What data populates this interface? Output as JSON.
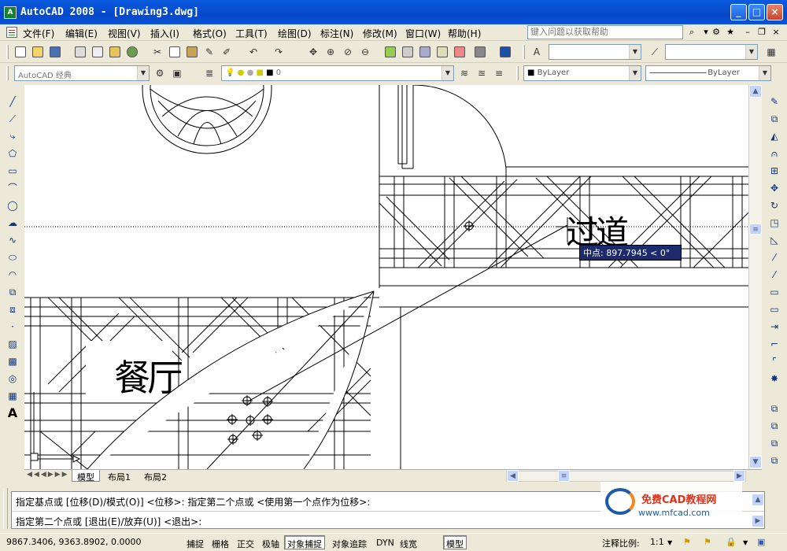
{
  "title": "AutoCAD 2008 - [Drawing3.dwg]",
  "app_icon_label": "A",
  "window_controls": {
    "minimize": "_",
    "maximize": "□",
    "close": "×"
  },
  "menu": [
    "文件(F)",
    "编辑(E)",
    "视图(V)",
    "插入(I)",
    "格式(O)",
    "工具(T)",
    "绘图(D)",
    "标注(N)",
    "修改(M)",
    "窗口(W)",
    "帮助(H)"
  ],
  "help_search": {
    "placeholder": "键入问题以获取帮助"
  },
  "doc_controls": {
    "minimize": "–",
    "restore": "❐",
    "close": "×"
  },
  "workspace": {
    "value": "AutoCAD 经典"
  },
  "layer": {
    "value": "0"
  },
  "color": {
    "value": "ByLayer"
  },
  "linetype": {
    "value": "ByLayer"
  },
  "drawing": {
    "label_restaurant": "餐厅",
    "label_corridor": "过道",
    "tooltip": "中点: 897.7945 < 0°"
  },
  "tabs": [
    "模型",
    "布局1",
    "布局2"
  ],
  "active_tab": "模型",
  "command": {
    "line1": "指定基点或 [位移(D)/模式(O)] <位移>: 指定第二个点或 <使用第一个点作为位移>:",
    "line2": "指定第二个点或 [退出(E)/放弃(U)] <退出>:"
  },
  "watermark": {
    "site": "www.mfcad.com",
    "name": "免费CAD教程网"
  },
  "status": {
    "coords": "9867.3406, 9363.8902, 0.0000",
    "toggles": [
      "捕捉",
      "栅格",
      "正交",
      "极轴",
      "对象捕捉",
      "对象追踪",
      "DYN",
      "线宽",
      "模型"
    ],
    "toggles_on": [
      "对象捕捉",
      "模型"
    ],
    "annotation_scale_label": "注释比例:",
    "annotation_scale_value": "1:1"
  },
  "colors": {
    "titlebar": "#0A53D6",
    "chrome": "#ECE9D8",
    "tooltip_bg": "#1D2A6B",
    "canvas": "#FFFFFF"
  },
  "icons": {
    "left_toolbar": [
      "line-icon",
      "construction-line-icon",
      "polyline-icon",
      "polygon-icon",
      "rectangle-icon",
      "arc-icon",
      "circle-icon",
      "revision-cloud-icon",
      "spline-icon",
      "ellipse-icon",
      "ellipse-arc-icon",
      "insert-block-icon",
      "make-block-icon",
      "point-icon",
      "hatch-icon",
      "gradient-icon",
      "region-icon",
      "table-icon",
      "multiline-text-icon"
    ],
    "right_toolbar": [
      "erase-icon",
      "copy-icon",
      "mirror-icon",
      "offset-icon",
      "array-icon",
      "move-icon",
      "rotate-icon",
      "scale-icon",
      "stretch-icon",
      "trim-icon",
      "extend-icon",
      "break-at-point-icon",
      "break-icon",
      "join-icon",
      "chamfer-icon",
      "fillet-icon",
      "explode-icon",
      "draworder-icon",
      "bring-to-front-icon",
      "send-to-back-icon",
      "send-under-icon"
    ]
  }
}
